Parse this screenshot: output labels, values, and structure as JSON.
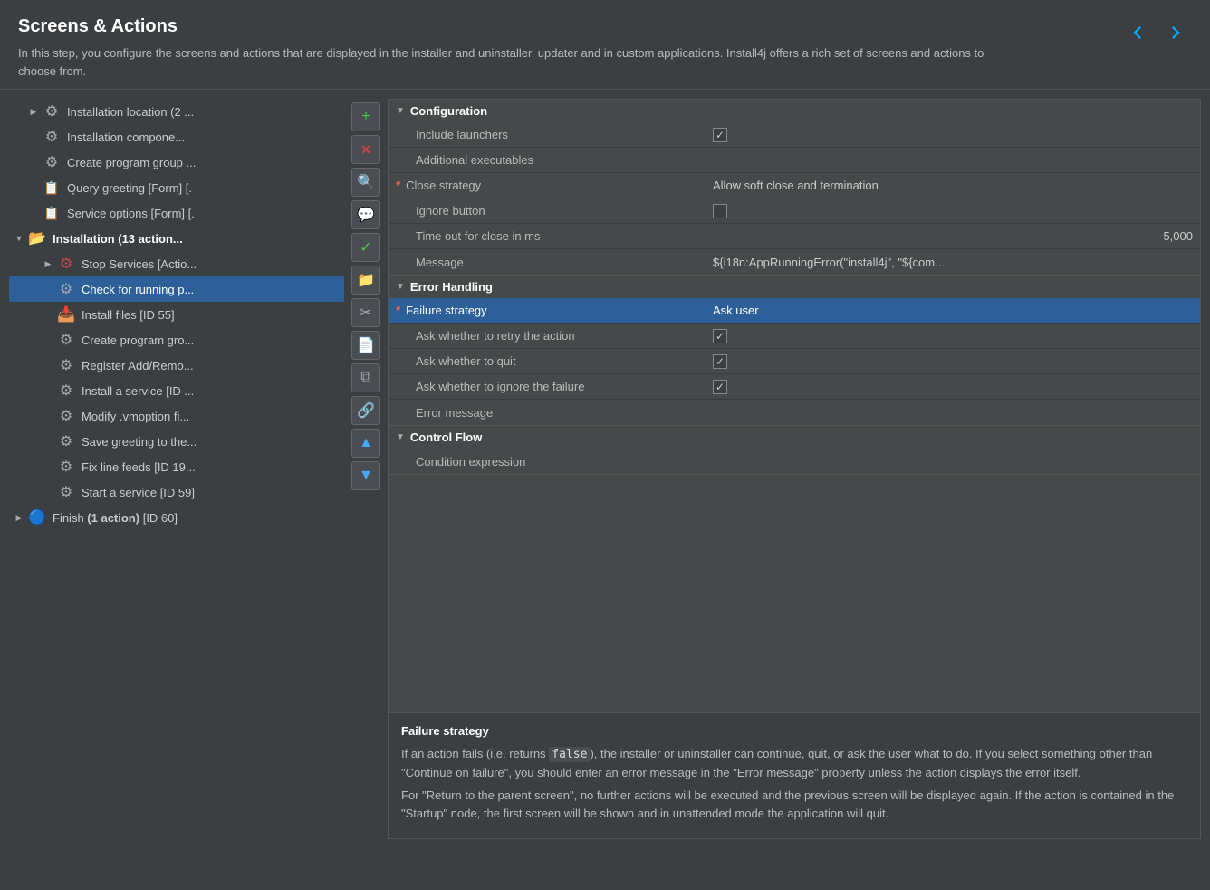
{
  "header": {
    "title": "Screens & Actions",
    "description": "In this step, you configure the screens and actions that are displayed in the installer and uninstaller, updater and in custom applications. Install4j offers a rich set of screens and actions to choose from."
  },
  "tree": {
    "items": [
      {
        "id": "install-loc",
        "label": "Installation location (2 ...",
        "indent": 1,
        "expand": "right",
        "icon": "gear",
        "selected": false
      },
      {
        "id": "install-comp",
        "label": "Installation compone...",
        "indent": 1,
        "expand": "empty",
        "icon": "gear",
        "selected": false
      },
      {
        "id": "create-prog",
        "label": "Create program group ...",
        "indent": 1,
        "expand": "empty",
        "icon": "gear",
        "selected": false
      },
      {
        "id": "query-greet",
        "label": "Query greeting [Form] [.",
        "indent": 1,
        "expand": "empty",
        "icon": "form",
        "selected": false
      },
      {
        "id": "service-opts",
        "label": "Service options [Form] [.",
        "indent": 1,
        "expand": "empty",
        "icon": "form",
        "selected": false
      },
      {
        "id": "installation",
        "label": "Installation (13 action...",
        "indent": 0,
        "expand": "down",
        "icon": "folder-open",
        "selected": false
      },
      {
        "id": "stop-services",
        "label": "Stop Services [Actio...",
        "indent": 2,
        "expand": "right",
        "icon": "stop-gear",
        "selected": false
      },
      {
        "id": "check-running",
        "label": "Check for running p...",
        "indent": 2,
        "expand": "empty",
        "icon": "gear",
        "selected": true
      },
      {
        "id": "install-files",
        "label": "Install files [ID 55]",
        "indent": 2,
        "expand": "empty",
        "icon": "install",
        "selected": false
      },
      {
        "id": "create-prog2",
        "label": "Create program gro...",
        "indent": 2,
        "expand": "empty",
        "icon": "gear",
        "selected": false
      },
      {
        "id": "register-add",
        "label": "Register Add/Remo...",
        "indent": 2,
        "expand": "empty",
        "icon": "gear",
        "selected": false
      },
      {
        "id": "install-service",
        "label": "Install a service [ID ...",
        "indent": 2,
        "expand": "empty",
        "icon": "gear",
        "selected": false
      },
      {
        "id": "modify-vm",
        "label": "Modify .vmoption fi...",
        "indent": 2,
        "expand": "empty",
        "icon": "gear",
        "selected": false
      },
      {
        "id": "save-greeting",
        "label": "Save greeting to the...",
        "indent": 2,
        "expand": "empty",
        "icon": "gear",
        "selected": false
      },
      {
        "id": "fix-line",
        "label": "Fix line feeds [ID 19...",
        "indent": 2,
        "expand": "empty",
        "icon": "gear",
        "selected": false
      },
      {
        "id": "start-service",
        "label": "Start a service [ID 59]",
        "indent": 2,
        "expand": "empty",
        "icon": "gear",
        "selected": false
      },
      {
        "id": "finish",
        "label": "Finish (1 action) [ID 60]",
        "indent": 0,
        "expand": "right",
        "icon": "finish",
        "selected": false
      }
    ]
  },
  "toolbar_buttons": [
    {
      "id": "add",
      "icon": "+",
      "style": "green",
      "label": "Add"
    },
    {
      "id": "remove",
      "icon": "✕",
      "style": "red",
      "label": "Remove"
    },
    {
      "id": "search",
      "icon": "🔍",
      "style": "blue",
      "label": "Search"
    },
    {
      "id": "message",
      "icon": "💬",
      "style": "yellow",
      "label": "Message"
    },
    {
      "id": "check",
      "icon": "✓",
      "style": "check",
      "label": "Check"
    },
    {
      "id": "folder",
      "icon": "📁",
      "style": "folder-yellow",
      "label": "Folder"
    },
    {
      "id": "cut",
      "icon": "✂",
      "style": "scissors",
      "label": "Cut"
    },
    {
      "id": "page",
      "icon": "📄",
      "style": "page",
      "label": "Page"
    },
    {
      "id": "pages",
      "icon": "⧉",
      "style": "pages",
      "label": "Pages"
    },
    {
      "id": "link",
      "icon": "🔗",
      "style": "link",
      "label": "Link"
    },
    {
      "id": "up",
      "icon": "▲",
      "style": "up-arrow",
      "label": "Move Up"
    },
    {
      "id": "down",
      "icon": "▼",
      "style": "down-arrow",
      "label": "Move Down"
    }
  ],
  "properties": {
    "sections": [
      {
        "id": "configuration",
        "title": "Configuration",
        "collapsed": false,
        "rows": [
          {
            "id": "include-launchers",
            "label": "Include launchers",
            "required": false,
            "indent": "sub",
            "value_type": "checkbox",
            "checked": true
          },
          {
            "id": "add-executables",
            "label": "Additional executables",
            "required": false,
            "indent": "sub",
            "value_type": "text",
            "value": ""
          },
          {
            "id": "close-strategy",
            "label": "Close strategy",
            "required": true,
            "indent": "sub",
            "value_type": "text",
            "value": "Allow soft close and termination"
          },
          {
            "id": "ignore-button",
            "label": "Ignore button",
            "required": false,
            "indent": "sub",
            "value_type": "checkbox",
            "checked": false
          },
          {
            "id": "timeout",
            "label": "Time out for close in ms",
            "required": false,
            "indent": "sub",
            "value_type": "text",
            "value": "5,000",
            "align": "right"
          },
          {
            "id": "message",
            "label": "Message",
            "required": false,
            "indent": "sub",
            "value_type": "text",
            "value": "${i18n:AppRunningError(\"install4j\", \"${com..."
          }
        ]
      },
      {
        "id": "error-handling",
        "title": "Error Handling",
        "collapsed": false,
        "rows": [
          {
            "id": "failure-strategy",
            "label": "Failure strategy",
            "required": true,
            "indent": "sub",
            "value_type": "text",
            "value": "Ask user",
            "highlighted": true
          },
          {
            "id": "ask-retry",
            "label": "Ask whether to retry the action",
            "required": false,
            "indent": "sub2",
            "value_type": "checkbox",
            "checked": true
          },
          {
            "id": "ask-quit",
            "label": "Ask whether to quit",
            "required": false,
            "indent": "sub2",
            "value_type": "checkbox",
            "checked": true
          },
          {
            "id": "ask-ignore",
            "label": "Ask whether to ignore the failure",
            "required": false,
            "indent": "sub2",
            "value_type": "checkbox",
            "checked": true
          },
          {
            "id": "error-message",
            "label": "Error message",
            "required": false,
            "indent": "sub",
            "value_type": "text",
            "value": ""
          }
        ]
      },
      {
        "id": "control-flow",
        "title": "Control Flow",
        "collapsed": false,
        "rows": [
          {
            "id": "condition-expr",
            "label": "Condition expression",
            "required": false,
            "indent": "sub",
            "value_type": "text",
            "value": ""
          }
        ]
      }
    ]
  },
  "help": {
    "title": "Failure strategy",
    "paragraphs": [
      "If an action fails (i.e. returns false), the installer or uninstaller can continue, quit, or ask the user what to do. If you select something other than \"Continue on failure\", you should enter an error message in the \"Error message\" property unless the action displays the error itself.",
      "For \"Return to the parent screen\", no further actions will be executed and the previous screen will be displayed again. If the action is contained in the \"Startup\" node, the first screen will be shown and in unattended mode the application will quit."
    ],
    "code_word": "false"
  }
}
